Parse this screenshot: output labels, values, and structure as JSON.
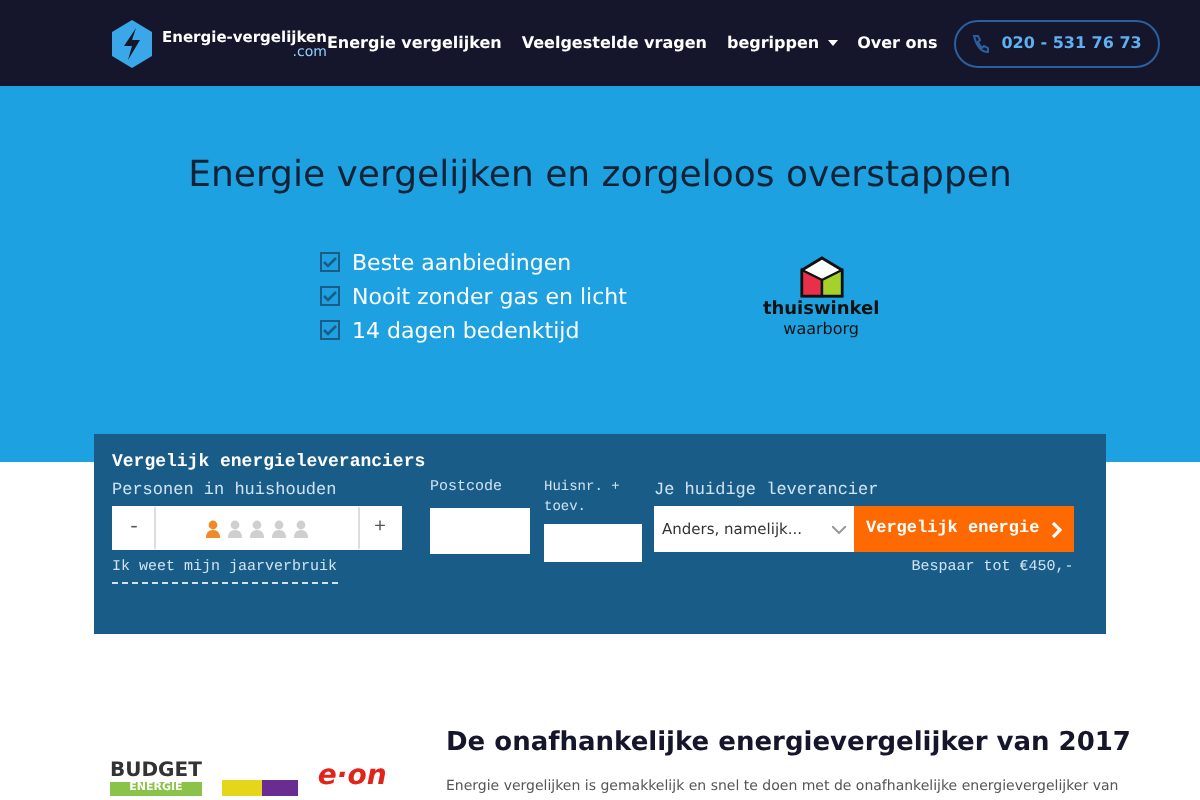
{
  "navbar": {
    "logo_text": "Energie-vergelijken",
    "logo_suffix": ".com",
    "links": [
      {
        "label": "Energie vergelijken",
        "dropdown": false
      },
      {
        "label": "Veelgestelde vragen",
        "dropdown": false
      },
      {
        "label": "begrippen",
        "dropdown": true
      },
      {
        "label": "Over ons",
        "dropdown": false
      }
    ],
    "phone": "020 - 531 76 73"
  },
  "hero": {
    "title": "Energie vergelijken en zorgeloos overstappen",
    "benefits": [
      "Beste aanbiedingen",
      "Nooit zonder gas en licht",
      "14 dagen bedenktijd"
    ],
    "badge": {
      "name": "thuiswinkel",
      "sub": "waarborg"
    }
  },
  "form": {
    "title": "Vergelijk energieleveranciers",
    "persons_label": "Personen in huishouden",
    "minus": "-",
    "plus": "+",
    "persons": [
      {
        "selected": true
      },
      {
        "selected": false
      },
      {
        "selected": false
      },
      {
        "selected": false
      },
      {
        "selected": false
      }
    ],
    "usage_link": "Ik weet mijn jaarverbruik",
    "postcode_label": "Postcode",
    "house_label": "Huisnr. + toev.",
    "supplier_label": "Je huidige leverancier",
    "supplier_value": "Anders, namelijk...",
    "submit": "Vergelijk energie",
    "savings": "Bespaar tot €450,-"
  },
  "section": {
    "logos": [
      {
        "kind": "budget",
        "text": "BUDGET",
        "sub": "ENERGIE"
      },
      {
        "kind": "blocks"
      },
      {
        "kind": "eon",
        "text": "e·on"
      }
    ],
    "heading": "De onafhankelijke energievergelijker van 2017",
    "paragraph": "Energie vergelijken is gemakkelijk en snel te doen met de onafhankelijke energievergelijker van"
  }
}
